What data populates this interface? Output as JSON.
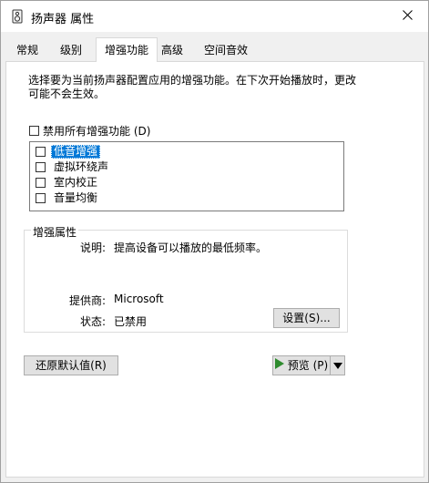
{
  "window": {
    "title": "扬声器 属性"
  },
  "tabs": [
    {
      "label": "常规"
    },
    {
      "label": "级别"
    },
    {
      "label": "增强功能"
    },
    {
      "label": "高级"
    },
    {
      "label": "空间音效"
    }
  ],
  "description": "选择要为当前扬声器配置应用的增强功能。在下次开始播放时，更改可能不会生效。",
  "disable_all": {
    "label": "禁用所有增强功能 (D)",
    "checked": false
  },
  "enhancements": [
    {
      "label": "低音增强",
      "checked": false,
      "selected": true
    },
    {
      "label": "虚拟环绕声",
      "checked": false
    },
    {
      "label": "室内校正",
      "checked": false
    },
    {
      "label": "音量均衡",
      "checked": false
    }
  ],
  "properties": {
    "title": "增强属性",
    "description_label": "说明:",
    "description_value": "提高设备可以播放的最低频率。",
    "provider_label": "提供商:",
    "provider_value": "Microsoft",
    "status_label": "状态:",
    "status_value": "已禁用",
    "settings_button": "设置(S)..."
  },
  "buttons": {
    "restore_defaults": "还原默认值(R)",
    "preview": "预览 (P)"
  },
  "icons": {
    "window": "speaker-icon",
    "close": "close-icon",
    "preview": "play-icon",
    "dropdown": "chevron-down-icon"
  },
  "colors": {
    "selection": "#0078d7",
    "play": "#2e8b2e"
  }
}
